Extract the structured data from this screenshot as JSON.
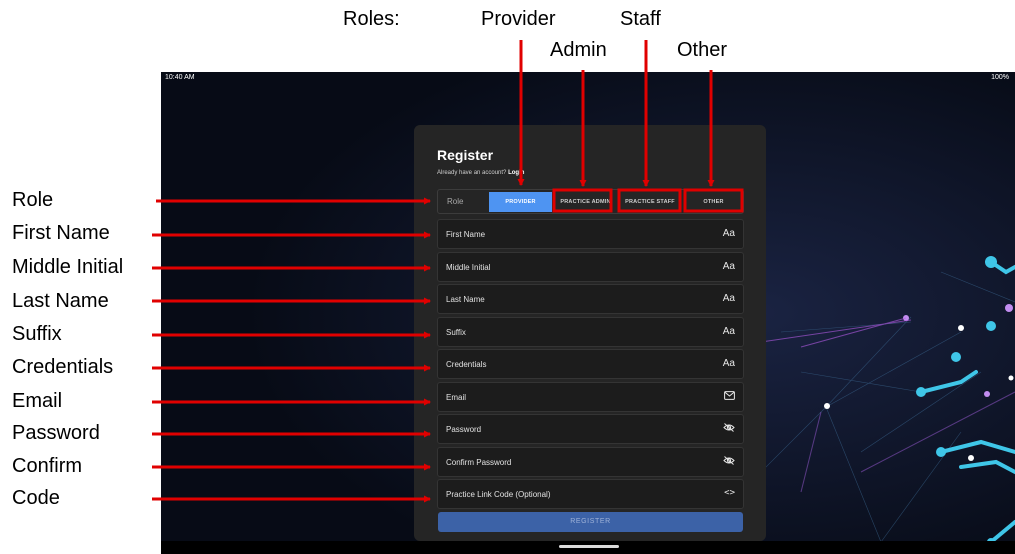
{
  "annotations": {
    "roles_heading": "Roles:",
    "top_labels": {
      "provider": "Provider",
      "staff": "Staff",
      "admin": "Admin",
      "other": "Other"
    },
    "left_labels": [
      "Role",
      "First Name",
      "Middle Initial",
      "Last Name",
      "Suffix",
      "Credentials",
      "Email",
      "Password",
      "Confirm",
      "Code"
    ],
    "arrow_color": "#e00000"
  },
  "status_bar": {
    "time": "10:40 AM",
    "battery": "100%"
  },
  "register_card": {
    "title": "Register",
    "login_prompt": "Already have an account? ",
    "login_link": "Login",
    "role": {
      "label": "Role",
      "options": [
        "PROVIDER",
        "PRACTICE ADMIN",
        "PRACTICE STAFF",
        "OTHER"
      ],
      "selected": "PROVIDER"
    },
    "fields": [
      {
        "label": "First Name",
        "icon": "text-format-icon",
        "glyph": "Aa"
      },
      {
        "label": "Middle Initial",
        "icon": "text-format-icon",
        "glyph": "Aa"
      },
      {
        "label": "Last Name",
        "icon": "text-format-icon",
        "glyph": "Aa"
      },
      {
        "label": "Suffix",
        "icon": "text-format-icon",
        "glyph": "Aa"
      },
      {
        "label": "Credentials",
        "icon": "text-format-icon",
        "glyph": "Aa"
      },
      {
        "label": "Email",
        "icon": "mail-icon"
      },
      {
        "label": "Password",
        "icon": "eye-off-icon"
      },
      {
        "label": "Confirm Password",
        "icon": "eye-off-icon"
      },
      {
        "label": "Practice Link Code (Optional)",
        "icon": "code-icon",
        "glyph": "<>"
      }
    ],
    "register_button": "REGISTER"
  },
  "colors": {
    "accent": "#4e94f2",
    "button": "#3c62a7",
    "card": "#252525",
    "background": "#0a0f1c"
  }
}
